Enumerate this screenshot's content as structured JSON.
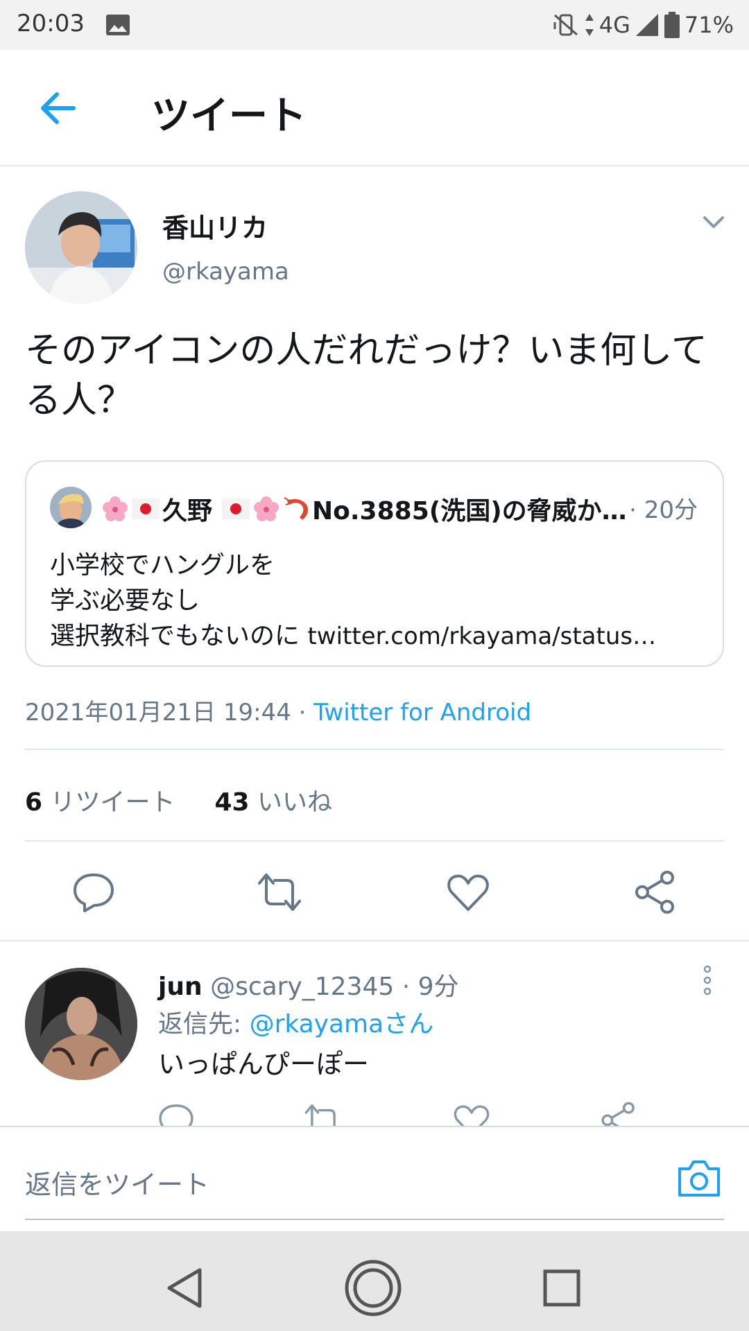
{
  "status_bar": {
    "time": "20:03",
    "network": "4G",
    "battery": "71%"
  },
  "app_bar": {
    "title": "ツイート"
  },
  "tweet": {
    "author_name": "香山リカ",
    "author_handle": "@rkayama",
    "text": "そのアイコンの人だれだっけ？いま何してる人？",
    "quote": {
      "name_text": "久野",
      "name_suffix": "No.3885(洗国)の脅威か…",
      "time": "· 20分",
      "body_lines": [
        "小学校でハングルを",
        "学ぶ必要なし",
        "選択教科でもないのに"
      ],
      "link": "twitter.com/rkayama/status…"
    },
    "timestamp": "2021年01月21日 19:44 · ",
    "source": "Twitter for Android",
    "retweet_count": "6",
    "retweet_label": "リツイート",
    "like_count": "43",
    "like_label": "いいね"
  },
  "reply": {
    "name": "jun",
    "handle": "@scary_12345",
    "time": "· 9分",
    "reply_to_prefix": "返信先: ",
    "reply_to_handle": "@rkayamaさん",
    "text": "いっぱんぴーぽー"
  },
  "compose": {
    "placeholder": "返信をツイート"
  },
  "colors": {
    "accent": "#1da1f2",
    "text": "#14171a",
    "muted": "#657786",
    "border": "#e1e8ed"
  }
}
